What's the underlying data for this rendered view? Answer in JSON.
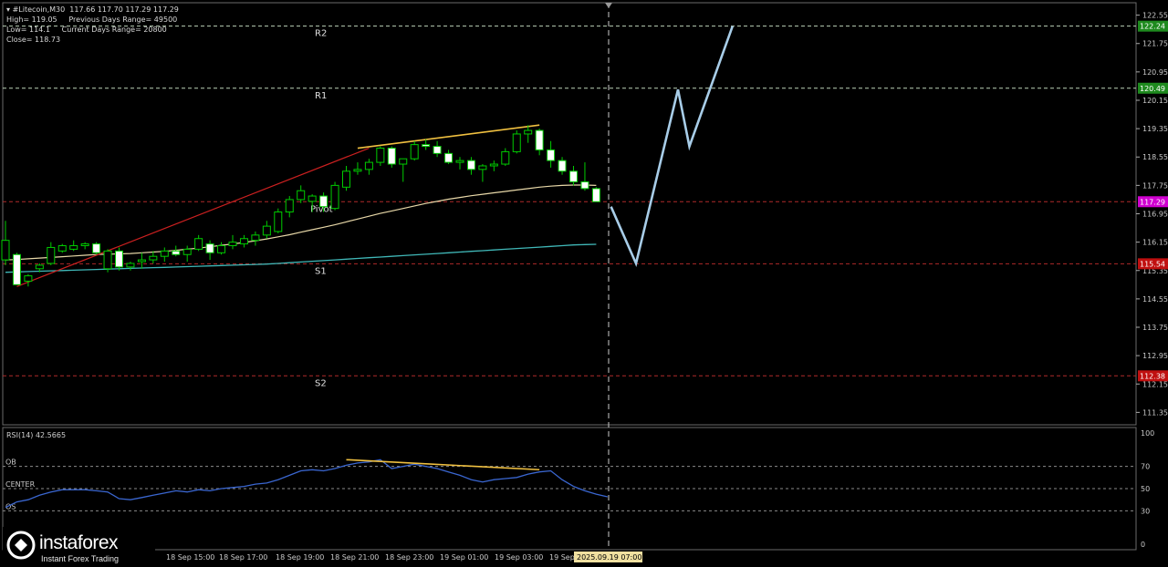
{
  "header": {
    "symbol_line": "#Litecoin,M30  117.66 117.70 117.29 117.29",
    "high_label": "High= 119.05",
    "prev_range_label": "Previous Days Range= 49500",
    "low_label": "Low= 114.1",
    "curr_range_label": "Current Days Range= 20800",
    "close_label": "Close= 118.73"
  },
  "logo": {
    "brand": "instaforex",
    "tagline": "Instant Forex Trading"
  },
  "colors": {
    "background": "#000000",
    "bull_candle": "#000000",
    "bear_candle": "#ffffff",
    "candle_outline": "#00cc00",
    "pivot_lines": "#b02a2a",
    "resistance_levels": "#bcd2b8",
    "ma_fast": "#e8d8a8",
    "ma_slow": "#40b8b8",
    "forecast": "#a8cde8",
    "rsi_line": "#3a66d0",
    "divergence": "#f0c040",
    "trendline": "#cc2020",
    "price_badge": "#d000d0",
    "level_up_badge": "#1e8a1e",
    "level_down_badge": "#c01010",
    "time_badge": "#f0e0a0"
  },
  "chart_data": [
    {
      "type": "candlestick",
      "title": "",
      "ylim": [
        111.0,
        122.9
      ],
      "y_ticks": [
        122.55,
        121.75,
        120.95,
        120.15,
        119.35,
        118.55,
        117.75,
        116.95,
        116.15,
        115.35,
        114.55,
        113.75,
        112.95,
        112.15,
        111.35
      ],
      "x_tick_labels": [
        "18 Sep 15:00",
        "18 Sep 17:00",
        "18 Sep 19:00",
        "18 Sep 21:00",
        "18 Sep 23:00",
        "19 Sep 01:00",
        "19 Sep 03:00",
        "19 Sep"
      ],
      "current_time_label": "2025.09.19 07:00",
      "candles": [
        {
          "o": 115.65,
          "h": 116.75,
          "l": 115.5,
          "c": 116.2
        },
        {
          "o": 115.8,
          "h": 115.85,
          "l": 114.95,
          "c": 114.95
        },
        {
          "o": 115.05,
          "h": 115.25,
          "l": 114.9,
          "c": 115.2
        },
        {
          "o": 115.4,
          "h": 115.55,
          "l": 115.3,
          "c": 115.5
        },
        {
          "o": 115.55,
          "h": 116.15,
          "l": 115.5,
          "c": 116.0
        },
        {
          "o": 115.9,
          "h": 116.1,
          "l": 115.85,
          "c": 116.05
        },
        {
          "o": 115.95,
          "h": 116.2,
          "l": 115.9,
          "c": 116.05
        },
        {
          "o": 116.05,
          "h": 116.15,
          "l": 115.95,
          "c": 116.1
        },
        {
          "o": 116.1,
          "h": 116.15,
          "l": 115.8,
          "c": 115.85
        },
        {
          "o": 115.4,
          "h": 115.95,
          "l": 115.3,
          "c": 115.9
        },
        {
          "o": 115.9,
          "h": 116.0,
          "l": 115.35,
          "c": 115.45
        },
        {
          "o": 115.45,
          "h": 115.6,
          "l": 115.35,
          "c": 115.55
        },
        {
          "o": 115.6,
          "h": 115.85,
          "l": 115.4,
          "c": 115.65
        },
        {
          "o": 115.65,
          "h": 115.9,
          "l": 115.55,
          "c": 115.75
        },
        {
          "o": 115.75,
          "h": 116.0,
          "l": 115.6,
          "c": 115.9
        },
        {
          "o": 115.9,
          "h": 116.05,
          "l": 115.75,
          "c": 115.8
        },
        {
          "o": 115.8,
          "h": 116.05,
          "l": 115.6,
          "c": 115.95
        },
        {
          "o": 115.95,
          "h": 116.35,
          "l": 115.9,
          "c": 116.25
        },
        {
          "o": 116.1,
          "h": 116.2,
          "l": 115.65,
          "c": 115.85
        },
        {
          "o": 115.85,
          "h": 116.15,
          "l": 115.8,
          "c": 116.05
        },
        {
          "o": 116.05,
          "h": 116.35,
          "l": 115.95,
          "c": 116.15
        },
        {
          "o": 116.1,
          "h": 116.35,
          "l": 116.0,
          "c": 116.25
        },
        {
          "o": 116.2,
          "h": 116.45,
          "l": 116.05,
          "c": 116.35
        },
        {
          "o": 116.35,
          "h": 116.75,
          "l": 116.25,
          "c": 116.6
        },
        {
          "o": 116.45,
          "h": 117.1,
          "l": 116.4,
          "c": 117.0
        },
        {
          "o": 117.0,
          "h": 117.45,
          "l": 116.85,
          "c": 117.35
        },
        {
          "o": 117.35,
          "h": 117.75,
          "l": 117.25,
          "c": 117.6
        },
        {
          "o": 117.3,
          "h": 117.5,
          "l": 117.0,
          "c": 117.45
        },
        {
          "o": 117.45,
          "h": 117.55,
          "l": 117.0,
          "c": 117.15
        },
        {
          "o": 117.1,
          "h": 117.85,
          "l": 117.05,
          "c": 117.75
        },
        {
          "o": 117.7,
          "h": 118.3,
          "l": 117.6,
          "c": 118.15
        },
        {
          "o": 118.15,
          "h": 118.4,
          "l": 118.05,
          "c": 118.2
        },
        {
          "o": 118.2,
          "h": 118.5,
          "l": 118.05,
          "c": 118.4
        },
        {
          "o": 118.4,
          "h": 118.85,
          "l": 118.3,
          "c": 118.8
        },
        {
          "o": 118.8,
          "h": 118.85,
          "l": 118.25,
          "c": 118.35
        },
        {
          "o": 118.35,
          "h": 118.5,
          "l": 117.85,
          "c": 118.5
        },
        {
          "o": 118.5,
          "h": 119.0,
          "l": 118.45,
          "c": 118.9
        },
        {
          "o": 118.9,
          "h": 119.05,
          "l": 118.75,
          "c": 118.85
        },
        {
          "o": 118.85,
          "h": 119.0,
          "l": 118.55,
          "c": 118.65
        },
        {
          "o": 118.65,
          "h": 118.75,
          "l": 118.35,
          "c": 118.4
        },
        {
          "o": 118.4,
          "h": 118.55,
          "l": 118.2,
          "c": 118.45
        },
        {
          "o": 118.45,
          "h": 118.55,
          "l": 118.05,
          "c": 118.2
        },
        {
          "o": 118.2,
          "h": 118.35,
          "l": 117.85,
          "c": 118.3
        },
        {
          "o": 118.3,
          "h": 118.45,
          "l": 118.15,
          "c": 118.35
        },
        {
          "o": 118.35,
          "h": 118.8,
          "l": 118.3,
          "c": 118.7
        },
        {
          "o": 118.7,
          "h": 119.3,
          "l": 118.65,
          "c": 119.2
        },
        {
          "o": 119.2,
          "h": 119.45,
          "l": 118.95,
          "c": 119.3
        },
        {
          "o": 119.3,
          "h": 119.35,
          "l": 118.6,
          "c": 118.75
        },
        {
          "o": 118.75,
          "h": 119.0,
          "l": 118.25,
          "c": 118.45
        },
        {
          "o": 118.45,
          "h": 118.55,
          "l": 118.05,
          "c": 118.15
        },
        {
          "o": 118.15,
          "h": 118.3,
          "l": 117.75,
          "c": 117.85
        },
        {
          "o": 117.85,
          "h": 118.4,
          "l": 117.6,
          "c": 117.66
        },
        {
          "o": 117.66,
          "h": 117.7,
          "l": 117.29,
          "c": 117.29
        }
      ],
      "ma_fast": [
        115.65,
        115.66,
        115.68,
        115.7,
        115.72,
        115.74,
        115.76,
        115.78,
        115.8,
        115.81,
        115.82,
        115.83,
        115.85,
        115.87,
        115.89,
        115.92,
        115.95,
        115.98,
        116.02,
        116.06,
        116.1,
        116.14,
        116.19,
        116.24,
        116.3,
        116.36,
        116.43,
        116.5,
        116.57,
        116.64,
        116.72,
        116.8,
        116.88,
        116.96,
        117.03,
        117.1,
        117.17,
        117.24,
        117.3,
        117.36,
        117.41,
        117.46,
        117.5,
        117.54,
        117.58,
        117.62,
        117.66,
        117.7,
        117.73,
        117.75,
        117.76,
        117.76,
        117.75
      ],
      "ma_slow": [
        115.3,
        115.31,
        115.32,
        115.33,
        115.34,
        115.35,
        115.36,
        115.37,
        115.38,
        115.39,
        115.4,
        115.41,
        115.42,
        115.43,
        115.44,
        115.45,
        115.46,
        115.47,
        115.48,
        115.49,
        115.5,
        115.51,
        115.52,
        115.53,
        115.55,
        115.57,
        115.59,
        115.61,
        115.63,
        115.65,
        115.67,
        115.69,
        115.71,
        115.73,
        115.75,
        115.77,
        115.79,
        115.81,
        115.83,
        115.85,
        115.87,
        115.89,
        115.91,
        115.93,
        115.95,
        115.97,
        115.99,
        116.01,
        116.03,
        116.05,
        116.07,
        116.08,
        116.09
      ],
      "levels": [
        {
          "label": "R2",
          "price": 122.24,
          "badge": "122.24",
          "style": "resist"
        },
        {
          "label": "R1",
          "price": 120.49,
          "badge": "120.49",
          "style": "resist"
        },
        {
          "label": "Pivot",
          "price": 117.29,
          "badge": "117.29",
          "style": "pivot"
        },
        {
          "label": "S1",
          "price": 115.54,
          "badge": "115.54",
          "style": "pivot"
        },
        {
          "label": "S2",
          "price": 112.38,
          "badge": "112.38",
          "style": "pivot"
        }
      ],
      "forecast_path": [
        {
          "t": 53.3,
          "p": 117.15
        },
        {
          "t": 55.5,
          "p": 115.55
        },
        {
          "t": 59.2,
          "p": 120.45
        },
        {
          "t": 60.2,
          "p": 118.85
        },
        {
          "t": 64.0,
          "p": 122.24
        }
      ],
      "trendline": [
        {
          "t": 1,
          "p": 114.9
        },
        {
          "t": 32,
          "p": 118.8
        }
      ],
      "divergence_price": [
        {
          "t": 31,
          "p": 118.8
        },
        {
          "t": 47,
          "p": 119.45
        }
      ]
    },
    {
      "type": "line",
      "title": "RSI(14) 42.5665",
      "ylim": [
        0,
        100
      ],
      "y_ticks": [
        100,
        70,
        50,
        30,
        0
      ],
      "level_labels": [
        {
          "label": "OB",
          "value": 70
        },
        {
          "label": "CENTER",
          "value": 50
        },
        {
          "label": "OS",
          "value": 30
        }
      ],
      "values": [
        33,
        38,
        40,
        44,
        47,
        49,
        49,
        49,
        48,
        47,
        41,
        40,
        42,
        44,
        46,
        48,
        47,
        49,
        48,
        50,
        51,
        52,
        54,
        55,
        58,
        62,
        66,
        67,
        66,
        68,
        71,
        73,
        74,
        76,
        68,
        70,
        72,
        70,
        68,
        65,
        62,
        58,
        56,
        58,
        59,
        60,
        63,
        65,
        66,
        58,
        52,
        48,
        45,
        42.6
      ],
      "divergence": [
        {
          "t": 30,
          "v": 76
        },
        {
          "t": 47,
          "v": 67
        }
      ]
    }
  ]
}
